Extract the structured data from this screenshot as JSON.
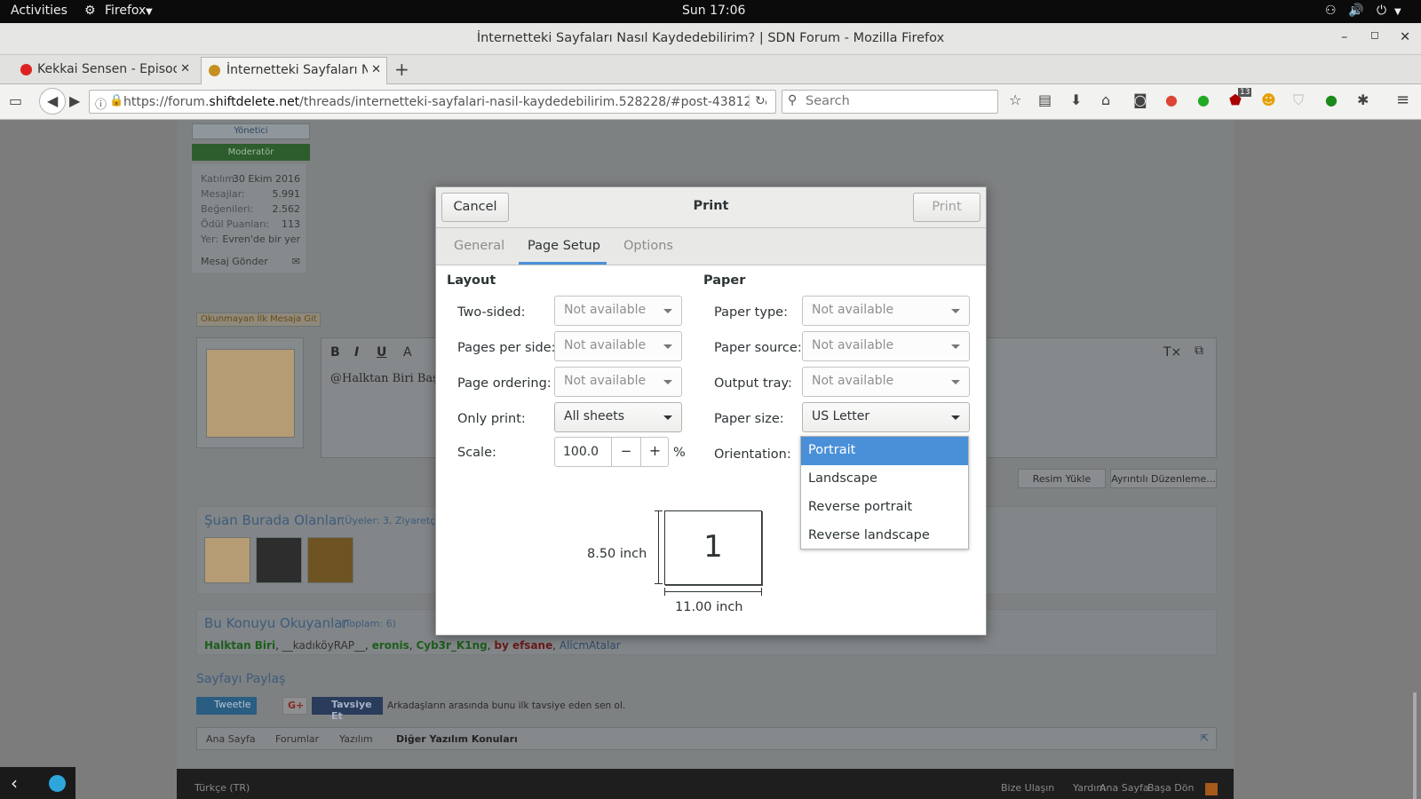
{
  "topbar": {
    "activities": "Activities",
    "app": "Firefox",
    "clock": "Sun 17:06"
  },
  "window": {
    "title": "İnternetteki Sayfaları Nasıl Kaydedebilirim? | SDN Forum - Mozilla Firefox"
  },
  "tabs": [
    {
      "label": "Kekkai Sensen - Episod"
    },
    {
      "label": "İnternetteki Sayfaları Na"
    }
  ],
  "nav": {
    "url_prefix": "https://forum.",
    "url_domain": "shiftdelete.net",
    "url_path": "/threads/internetteki-sayfalari-nasil-kaydedebilirim.528228/#post-4381265",
    "search_placeholder": "Search",
    "badge": "13"
  },
  "forum": {
    "role1": "Yönetici",
    "role2": "Moderatör",
    "stats": [
      {
        "k": "Katılım:",
        "v": "30 Ekim 2016"
      },
      {
        "k": "Mesajlar:",
        "v": "5.991"
      },
      {
        "k": "Beğenileri:",
        "v": "2.562"
      },
      {
        "k": "Ödül Puanları:",
        "v": "113"
      },
      {
        "k": "Yer:",
        "v": "Evren'de bir yer"
      }
    ],
    "send_message": "Mesaj Gönder",
    "unread_btn": "Okunmayan İlk Mesaja Git",
    "editor_text": "@Halktan Biri Baştı",
    "upload_btn": "Resim Yükle",
    "advanced_btn": "Ayrıntılı Düzenleme...",
    "online_title": "Şuan Burada Olanlar",
    "online_sub": "(Üyeler: 3, Ziyaretçi",
    "readers_title": "Bu Konuyu Okuyanlar",
    "readers_sub": "(Toplam: 6)",
    "readers": [
      "Halktan Biri",
      "__kadıköyRAP__",
      "eronis",
      "Cyb3r_K1ng",
      "by efsane",
      "AlicmAtalar"
    ],
    "share_title": "Sayfayı Paylaş",
    "tweet": "Tweetle",
    "gplus": "G+",
    "fb": "Tavsiye Et",
    "fb_text": "Arkadaşların arasında bunu ilk tavsiye eden sen ol.",
    "breadcrumbs": [
      "Ana Sayfa",
      "Forumlar",
      "Yazılım",
      "Diğer Yazılım Konuları"
    ],
    "footer_lang": "Türkçe (TR)",
    "footer_links": [
      "Bize Ulaşın",
      "Yardım",
      "Ana Sayfa",
      "Başa Dön"
    ]
  },
  "dialog": {
    "cancel": "Cancel",
    "title": "Print",
    "print": "Print",
    "tabs": [
      "General",
      "Page Setup",
      "Options"
    ],
    "layout_header": "Layout",
    "paper_header": "Paper",
    "layout": {
      "two_sided": {
        "label": "Two-sided:",
        "value": "Not available"
      },
      "pages_per_side": {
        "label": "Pages per side:",
        "value": "Not available"
      },
      "page_ordering": {
        "label": "Page ordering:",
        "value": "Not available"
      },
      "only_print": {
        "label": "Only print:",
        "value": "All sheets"
      },
      "scale": {
        "label": "Scale:",
        "value": "100.0",
        "minus": "−",
        "plus": "+",
        "unit": "%"
      }
    },
    "paper": {
      "paper_type": {
        "label": "Paper type:",
        "value": "Not available"
      },
      "paper_source": {
        "label": "Paper source:",
        "value": "Not available"
      },
      "output_tray": {
        "label": "Output tray:",
        "value": "Not available"
      },
      "paper_size": {
        "label": "Paper size:",
        "value": "US Letter"
      },
      "orientation": {
        "label": "Orientation:",
        "options": [
          "Portrait",
          "Landscape",
          "Reverse portrait",
          "Reverse landscape"
        ],
        "selected": "Portrait"
      }
    },
    "preview": {
      "page_number": "1",
      "height_label": "8.50 inch",
      "width_label": "11.00 inch"
    }
  },
  "colors": {
    "selection": "#4a90d9",
    "topbar": "#0b0b0b"
  }
}
